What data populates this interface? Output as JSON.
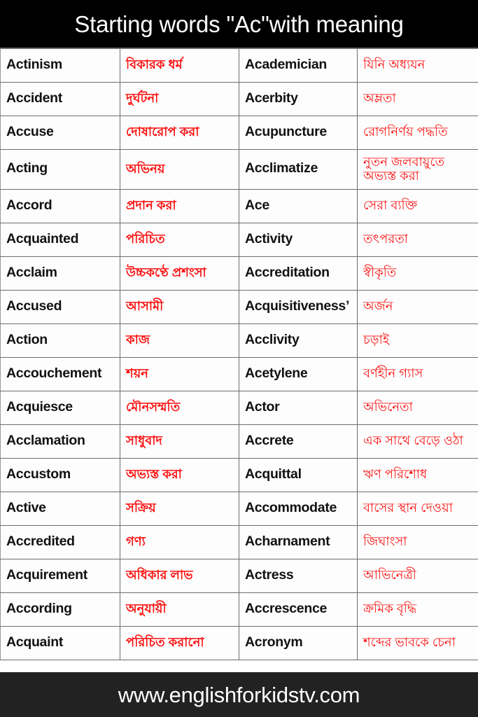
{
  "header": {
    "title": "Starting words \"Ac\"with meaning",
    "background_color": "#000000",
    "text_color": "#ffffff"
  },
  "footer": {
    "url": "www.englishforkidstv.com",
    "background_color": "#222222",
    "text_color": "#ffffff"
  },
  "theme": {
    "english_color": "#111111",
    "bengali_color": "#fb1111",
    "grid_color": "#6e6e6e",
    "cell_background": "#fdfdfd"
  },
  "table": {
    "column_count": 4,
    "row_count": 17,
    "columns": [
      "english",
      "bengali",
      "english",
      "bengali"
    ],
    "rows": [
      {
        "tall": false,
        "left": {
          "word": "Actinism",
          "meaning": "বিকারক ধর্ম"
        },
        "right": {
          "word": "Academician",
          "meaning": "যিনি অধ্যযন"
        }
      },
      {
        "tall": false,
        "left": {
          "word": "Accident",
          "meaning": "দুর্ঘটনা"
        },
        "right": {
          "word": "Acerbity",
          "meaning": "অম্লতা"
        }
      },
      {
        "tall": false,
        "left": {
          "word": "Accuse",
          "meaning": "দোষারোপ করা"
        },
        "right": {
          "word": "Acupuncture",
          "meaning": "রোগনির্ণয় পদ্ধতি"
        }
      },
      {
        "tall": true,
        "left": {
          "word": "Acting",
          "meaning": "অভিনয়"
        },
        "right": {
          "word": "Acclimatize",
          "meaning": "নুতন জলবায়ুতে অভ্যস্ত করা"
        }
      },
      {
        "tall": false,
        "left": {
          "word": "Accord",
          "meaning": "প্রদান করা"
        },
        "right": {
          "word": "Ace",
          "meaning": "সেরা ব্যক্তি"
        }
      },
      {
        "tall": false,
        "left": {
          "word": "Acquainted",
          "meaning": "পরিচিত"
        },
        "right": {
          "word": "Activity",
          "meaning": "তৎপরতা"
        }
      },
      {
        "tall": false,
        "left": {
          "word": "Acclaim",
          "meaning": "উচ্চকণ্ঠে প্রশংসা"
        },
        "right": {
          "word": "Accreditation",
          "meaning": "স্বীকৃতি"
        }
      },
      {
        "tall": false,
        "left": {
          "word": "Accused",
          "meaning": "আসামী"
        },
        "right": {
          "word": "Acquisitiveness’",
          "meaning": "অর্জন"
        }
      },
      {
        "tall": false,
        "left": {
          "word": "Action",
          "meaning": "কাজ"
        },
        "right": {
          "word": "Acclivity",
          "meaning": "চড়াই"
        }
      },
      {
        "tall": false,
        "left": {
          "word": "Accouchement",
          "meaning": "শয়ন"
        },
        "right": {
          "word": "Acetylene",
          "meaning": "বর্ণহীন গ্যাস"
        }
      },
      {
        "tall": false,
        "left": {
          "word": "Acquiesce",
          "meaning": "মৌনসম্মতি"
        },
        "right": {
          "word": "Actor",
          "meaning": "অভিনেতা"
        }
      },
      {
        "tall": false,
        "left": {
          "word": "Acclamation",
          "meaning": "সাধুবাদ"
        },
        "right": {
          "word": "Accrete",
          "meaning": "এক সাথে বেড়ে ওঠা"
        }
      },
      {
        "tall": false,
        "left": {
          "word": "Accustom",
          "meaning": "অভ্যস্ত করা"
        },
        "right": {
          "word": "Acquittal",
          "meaning": "ঋণ পরিশোধ"
        }
      },
      {
        "tall": false,
        "left": {
          "word": "Active",
          "meaning": "সক্রিয়"
        },
        "right": {
          "word": "Accommodate",
          "meaning": "বাসের স্থান দেওয়া"
        }
      },
      {
        "tall": false,
        "left": {
          "word": "Accredited",
          "meaning": "গণ্য"
        },
        "right": {
          "word": "Acharnament",
          "meaning": "জিঘাংসা"
        }
      },
      {
        "tall": false,
        "left": {
          "word": "Acquirement",
          "meaning": "অধিকার লাভ"
        },
        "right": {
          "word": "Actress",
          "meaning": "আভিনেত্রী"
        }
      },
      {
        "tall": false,
        "left": {
          "word": "According",
          "meaning": "অনুযায়ী"
        },
        "right": {
          "word": "Accrescence",
          "meaning": "ক্রমিক বৃদ্ধি"
        }
      },
      {
        "tall": false,
        "left": {
          "word": "Acquaint",
          "meaning": "পরিচিত করানো"
        },
        "right": {
          "word": "Acronym",
          "meaning": "শব্দের ভাবকে চেনা"
        }
      }
    ]
  }
}
